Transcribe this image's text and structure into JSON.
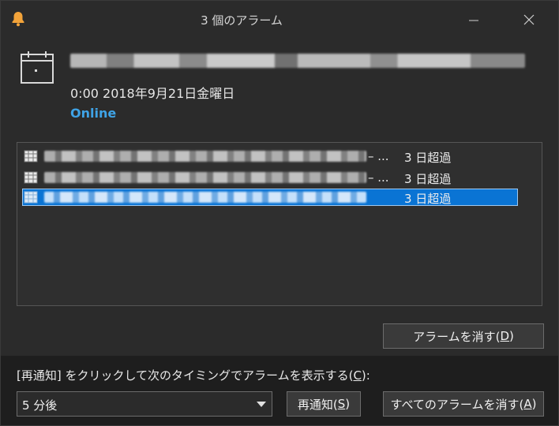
{
  "window": {
    "title": "3 個のアラーム",
    "icons": {
      "app": "bell-icon",
      "minimize": "minimize-icon",
      "close": "close-icon"
    }
  },
  "reminder": {
    "subject_visible": "",
    "time": "0:00 2018年9月21日金曜日",
    "location": "Online",
    "accent_color": "#3fa3e6"
  },
  "list": {
    "items": [
      {
        "name_visible": "",
        "ellipsis": "– ...",
        "due": "3 日超過",
        "selected": false
      },
      {
        "name_visible": "",
        "ellipsis": "– ...",
        "due": "3 日超過",
        "selected": false
      },
      {
        "name_visible": "",
        "ellipsis": "",
        "due": "3 日超過",
        "selected": true
      }
    ],
    "selected_color": "#0a74d4"
  },
  "buttons": {
    "dismiss": {
      "text": "アラームを消す(",
      "key": "D",
      "suffix": ")"
    },
    "snooze": {
      "text": "再通知(",
      "key": "S",
      "suffix": ")"
    },
    "dismiss_all": {
      "text": "すべてのアラームを消す(",
      "key": "A",
      "suffix": ")"
    }
  },
  "snooze": {
    "label_prefix": "[再通知] をクリックして次のタイミングでアラームを表示する(",
    "label_key": "C",
    "label_suffix": "):",
    "selected_value": "5 分後"
  }
}
